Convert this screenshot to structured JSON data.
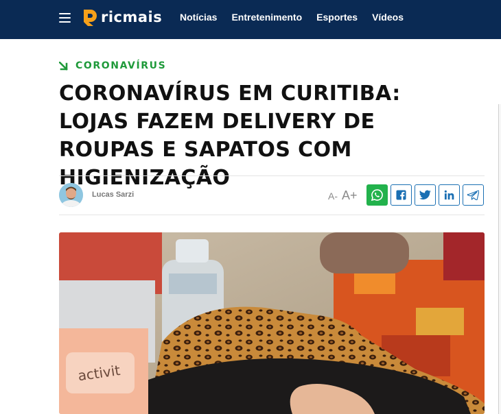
{
  "header": {
    "logo_text": "ricmais",
    "nav": [
      "Notícias",
      "Entretenimento",
      "Esportes",
      "Vídeos"
    ],
    "brand_color": "#0a2a54",
    "logo_accent": "#f6a01a"
  },
  "article": {
    "category": "CORONAVÍRUS",
    "category_color": "#1f9a3a",
    "title": "CORONAVÍRUS EM CURITIBA: LOJAS FAZEM DELIVERY DE ROUPAS E SAPATOS COM HIGIENIZAÇÃO",
    "author": "Lucas Sarzi"
  },
  "font_size_controls": {
    "decrease": "A-",
    "increase": "A+"
  },
  "share": {
    "buttons": [
      "whatsapp-icon",
      "facebook-icon",
      "twitter-icon",
      "linkedin-icon",
      "telegram-icon"
    ],
    "whatsapp_color": "#22b24c",
    "outline_color": "#1a6fb3"
  },
  "hero_image": {
    "description": "hand holding a leopard print shoe next to a water bottle",
    "shoe_text": "activit"
  }
}
